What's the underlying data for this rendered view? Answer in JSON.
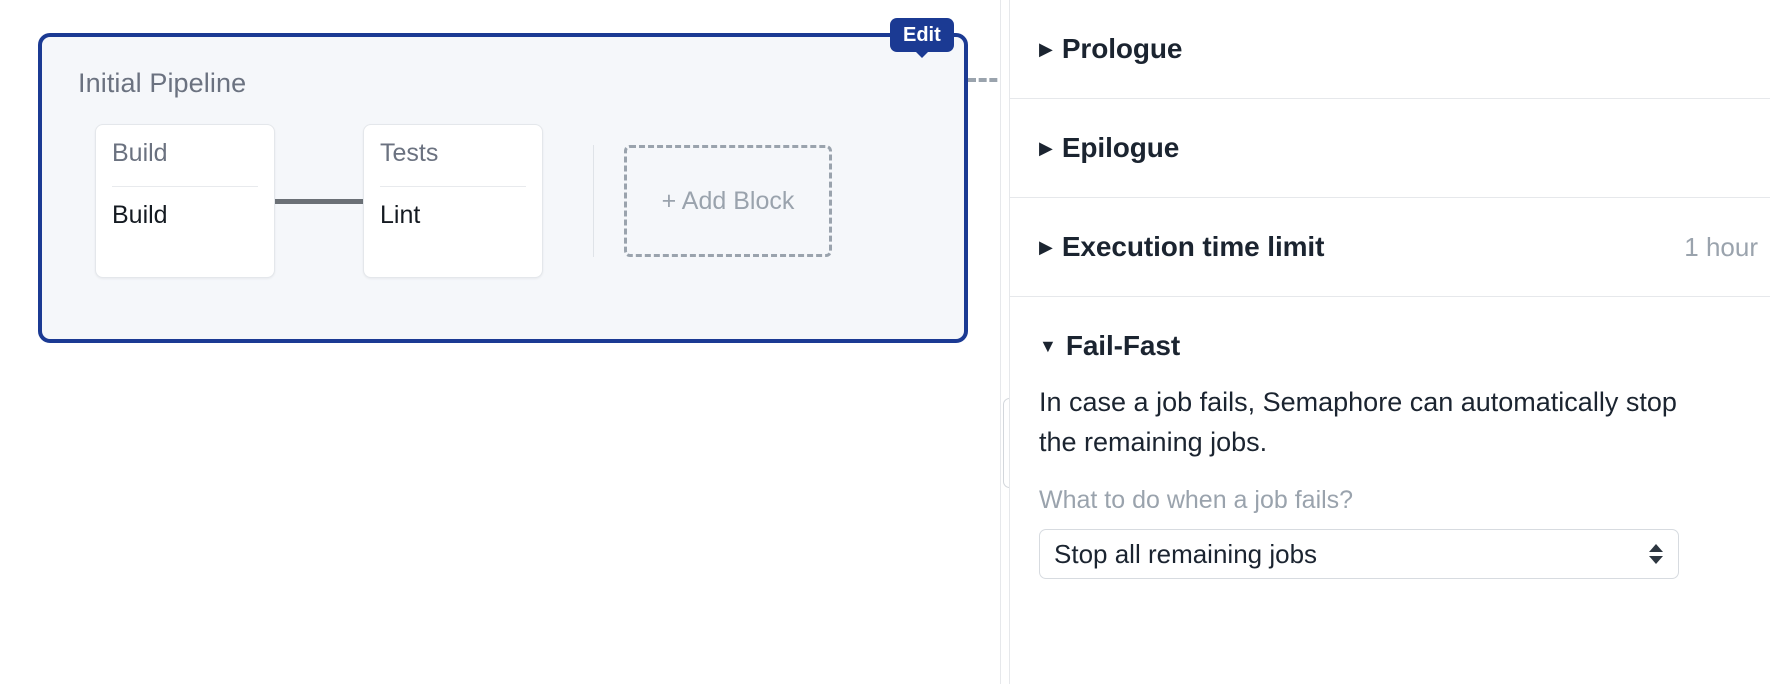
{
  "canvas": {
    "pipeline": {
      "title": "Initial Pipeline",
      "edit_label": "Edit",
      "accent_color": "#1b3a93",
      "background_color": "#f5f7fa",
      "blocks": [
        {
          "name": "Build",
          "job": "Build"
        },
        {
          "name": "Tests",
          "job": "Lint"
        }
      ],
      "add_block_label": "+ Add Block"
    }
  },
  "settings": {
    "sections": [
      {
        "id": "prologue",
        "title": "Prologue",
        "caret": "collapsed-caret-icon",
        "caret_glyph": "▶",
        "value": ""
      },
      {
        "id": "epilogue",
        "title": "Epilogue",
        "caret": "collapsed-caret-icon",
        "caret_glyph": "▶",
        "value": ""
      },
      {
        "id": "execution-time-limit",
        "title": "Execution time limit",
        "caret": "collapsed-caret-icon",
        "caret_glyph": "▶",
        "value": "1 hour"
      }
    ],
    "fail_fast": {
      "title": "Fail-Fast",
      "caret_glyph": "▼",
      "description": "In case a job fails, Semaphore can automatically stop the remaining jobs.",
      "question": "What to do when a job fails?",
      "selected_option": "Stop all remaining jobs",
      "options": [
        "Stop all remaining jobs"
      ]
    }
  }
}
